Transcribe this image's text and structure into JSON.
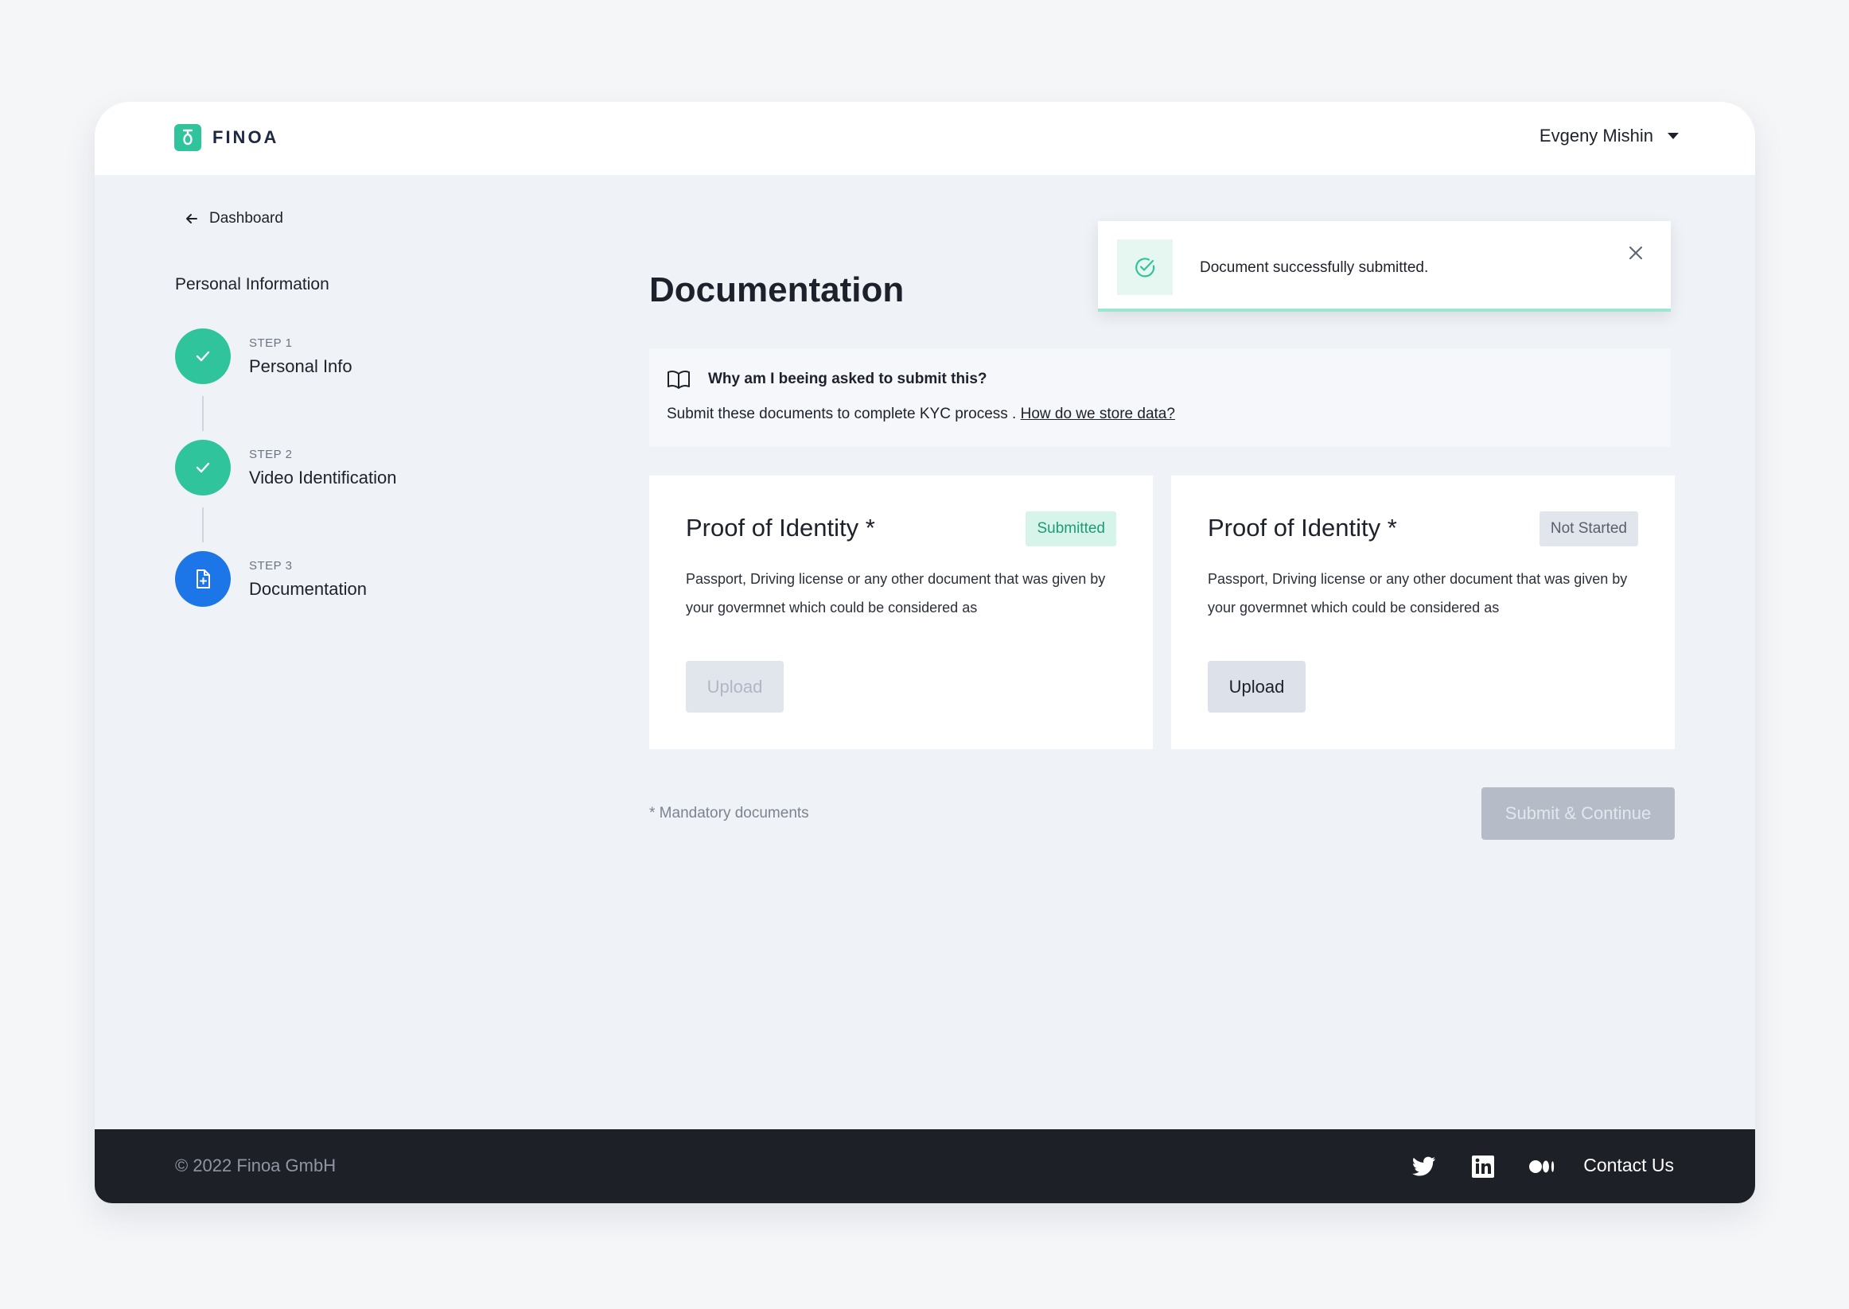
{
  "header": {
    "brand": "FINOA",
    "user_name": "Evgeny Mishin"
  },
  "nav": {
    "back_label": "Dashboard"
  },
  "sidebar": {
    "title": "Personal Information",
    "steps": [
      {
        "number": "STEP 1",
        "label": "Personal Info",
        "status": "done"
      },
      {
        "number": "STEP 2",
        "label": "Video Identification",
        "status": "done"
      },
      {
        "number": "STEP 3",
        "label": "Documentation",
        "status": "active"
      }
    ]
  },
  "main": {
    "title": "Documentation",
    "info": {
      "question": "Why am I beeing asked to submit this?",
      "text": "Submit these documents to complete KYC process . ",
      "link": "How do we store data?"
    },
    "cards": [
      {
        "title": "Proof of Identity *",
        "badge": "Submitted",
        "description": "Passport, Driving license or any other document that was given by your govermnet which could be considered as",
        "upload_label": "Upload",
        "upload_enabled": false
      },
      {
        "title": "Proof of Identity *",
        "badge": "Not Started",
        "description": "Passport, Driving license or any other document that was given by your govermnet which could be considered as",
        "upload_label": "Upload",
        "upload_enabled": true
      }
    ],
    "mandatory_note": "* Mandatory documents",
    "submit_label": "Submit & Continue"
  },
  "toast": {
    "message": "Document successfully submitted."
  },
  "footer": {
    "copyright": "© 2022 Finoa GmbH",
    "contact_label": "Contact Us"
  },
  "colors": {
    "accent_green": "#2fc49c",
    "accent_blue": "#1c76e8",
    "footer_bg": "#1e2028"
  }
}
